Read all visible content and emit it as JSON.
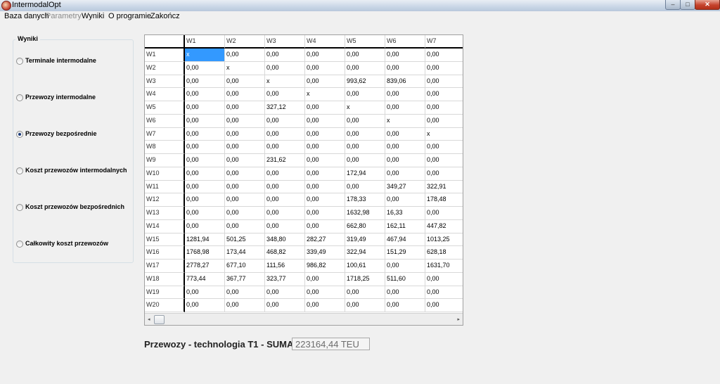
{
  "window": {
    "title": "IntermodalOpt",
    "minimize": "–",
    "maximize": "□",
    "close": "✕"
  },
  "menu": [
    {
      "label": "Baza danych",
      "enabled": true
    },
    {
      "label": "Parametry",
      "enabled": false
    },
    {
      "label": "Wyniki",
      "enabled": true
    },
    {
      "label": "O programie",
      "enabled": true
    },
    {
      "label": "Zakończ",
      "enabled": true
    }
  ],
  "group": {
    "title": "Wyniki",
    "options": [
      {
        "label": "Terminale intermodalne",
        "checked": false
      },
      {
        "label": "Przewozy intermodalne",
        "checked": false
      },
      {
        "label": "Przewozy bezpośrednie",
        "checked": true
      },
      {
        "label": "Koszt przewozów intermodalnych",
        "checked": false
      },
      {
        "label": "Koszt przewozów bezpośrednich",
        "checked": false
      },
      {
        "label": "Całkowity koszt przewozów",
        "checked": false
      }
    ]
  },
  "grid": {
    "columns": [
      "W1",
      "W2",
      "W3",
      "W4",
      "W5",
      "W6",
      "W7"
    ],
    "selected": {
      "row": 0,
      "col": 0
    },
    "rows": [
      {
        "label": "W1",
        "cells": [
          "x",
          "0,00",
          "0,00",
          "0,00",
          "0,00",
          "0,00",
          "0,00"
        ]
      },
      {
        "label": "W2",
        "cells": [
          "0,00",
          "x",
          "0,00",
          "0,00",
          "0,00",
          "0,00",
          "0,00"
        ]
      },
      {
        "label": "W3",
        "cells": [
          "0,00",
          "0,00",
          "x",
          "0,00",
          "993,62",
          "839,06",
          "0,00"
        ]
      },
      {
        "label": "W4",
        "cells": [
          "0,00",
          "0,00",
          "0,00",
          "x",
          "0,00",
          "0,00",
          "0,00"
        ]
      },
      {
        "label": "W5",
        "cells": [
          "0,00",
          "0,00",
          "327,12",
          "0,00",
          "x",
          "0,00",
          "0,00"
        ]
      },
      {
        "label": "W6",
        "cells": [
          "0,00",
          "0,00",
          "0,00",
          "0,00",
          "0,00",
          "x",
          "0,00"
        ]
      },
      {
        "label": "W7",
        "cells": [
          "0,00",
          "0,00",
          "0,00",
          "0,00",
          "0,00",
          "0,00",
          "x"
        ]
      },
      {
        "label": "W8",
        "cells": [
          "0,00",
          "0,00",
          "0,00",
          "0,00",
          "0,00",
          "0,00",
          "0,00"
        ]
      },
      {
        "label": "W9",
        "cells": [
          "0,00",
          "0,00",
          "231,62",
          "0,00",
          "0,00",
          "0,00",
          "0,00"
        ]
      },
      {
        "label": "W10",
        "cells": [
          "0,00",
          "0,00",
          "0,00",
          "0,00",
          "172,94",
          "0,00",
          "0,00"
        ]
      },
      {
        "label": "W11",
        "cells": [
          "0,00",
          "0,00",
          "0,00",
          "0,00",
          "0,00",
          "349,27",
          "322,91"
        ]
      },
      {
        "label": "W12",
        "cells": [
          "0,00",
          "0,00",
          "0,00",
          "0,00",
          "178,33",
          "0,00",
          "178,48"
        ]
      },
      {
        "label": "W13",
        "cells": [
          "0,00",
          "0,00",
          "0,00",
          "0,00",
          "1632,98",
          "16,33",
          "0,00"
        ]
      },
      {
        "label": "W14",
        "cells": [
          "0,00",
          "0,00",
          "0,00",
          "0,00",
          "662,80",
          "162,11",
          "447,82"
        ]
      },
      {
        "label": "W15",
        "cells": [
          "1281,94",
          "501,25",
          "348,80",
          "282,27",
          "319,49",
          "467,94",
          "1013,25"
        ]
      },
      {
        "label": "W16",
        "cells": [
          "1768,98",
          "173,44",
          "468,82",
          "339,49",
          "322,94",
          "151,29",
          "628,18"
        ]
      },
      {
        "label": "W17",
        "cells": [
          "2778,27",
          "677,10",
          "111,56",
          "986,82",
          "100,61",
          "0,00",
          "1631,70"
        ]
      },
      {
        "label": "W18",
        "cells": [
          "773,44",
          "367,77",
          "323,77",
          "0,00",
          "1718,25",
          "511,60",
          "0,00"
        ]
      },
      {
        "label": "W19",
        "cells": [
          "0,00",
          "0,00",
          "0,00",
          "0,00",
          "0,00",
          "0,00",
          "0,00"
        ]
      },
      {
        "label": "W20",
        "cells": [
          "0,00",
          "0,00",
          "0,00",
          "0,00",
          "0,00",
          "0,00",
          "0,00"
        ]
      }
    ],
    "scroll_left": "◂",
    "scroll_right": "▸"
  },
  "summary": {
    "label": "Przewozy - technologia T1 - SUMA:",
    "value": "223164,44 TEU"
  },
  "colors": {
    "selection": "#3399ff",
    "close_button": "#c5432d"
  },
  "icons": {
    "app": "app-logo-icon"
  }
}
